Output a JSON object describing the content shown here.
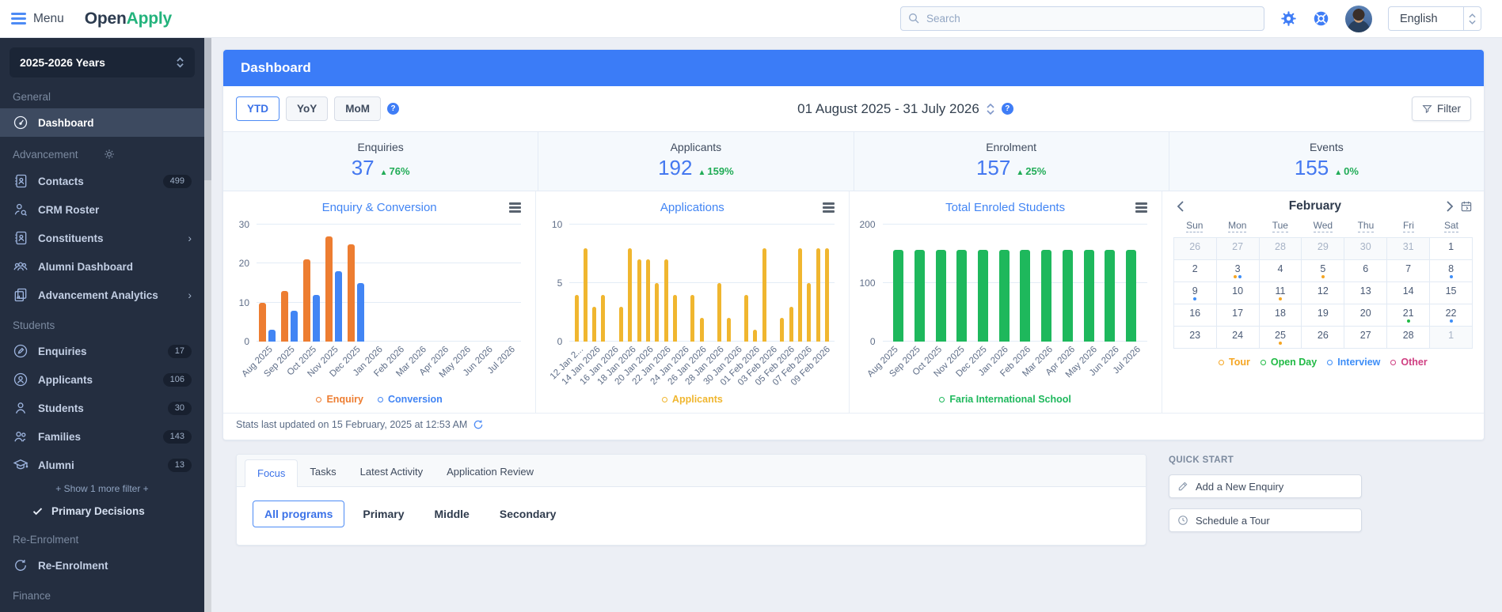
{
  "topbar": {
    "menu_label": "Menu",
    "logo_open": "Open",
    "logo_apply": "Apply",
    "search_placeholder": "Search",
    "language": "English",
    "icons": [
      "hamburger-icon",
      "search-icon",
      "gear-icon",
      "help-icon",
      "avatar"
    ]
  },
  "sidebar": {
    "year_selector": "2025-2026 Years",
    "groups": [
      {
        "label": "General",
        "items": [
          {
            "label": "Dashboard",
            "icon": "dashboard-gauge-icon",
            "active": true
          }
        ]
      },
      {
        "label": "Advancement",
        "gear_icon": "settings-gear-icon",
        "items": [
          {
            "label": "Contacts",
            "icon": "contacts-book-icon",
            "badge": "499"
          },
          {
            "label": "CRM Roster",
            "icon": "person-search-icon"
          },
          {
            "label": "Constituents",
            "icon": "constituents-book-icon",
            "chevron": true
          },
          {
            "label": "Alumni Dashboard",
            "icon": "people-group-icon"
          },
          {
            "label": "Advancement Analytics",
            "icon": "analytics-pages-icon",
            "chevron": true
          }
        ]
      },
      {
        "label": "Students",
        "items": [
          {
            "label": "Enquiries",
            "icon": "pencil-circle-icon",
            "badge": "17"
          },
          {
            "label": "Applicants",
            "icon": "person-circle-icon",
            "badge": "106"
          },
          {
            "label": "Students",
            "icon": "person-icon",
            "badge": "30"
          },
          {
            "label": "Families",
            "icon": "two-people-icon",
            "badge": "143"
          },
          {
            "label": "Alumni",
            "icon": "graduation-cap-icon",
            "badge": "13"
          }
        ],
        "show_more": "+ Show 1 more filter +",
        "decision_filter": "Primary Decisions"
      },
      {
        "label": "Re-Enrolment",
        "items": [
          {
            "label": "Re-Enrolment",
            "icon": "refresh-icon"
          }
        ]
      },
      {
        "label": "Finance",
        "items": []
      }
    ]
  },
  "main": {
    "title": "Dashboard",
    "period_buttons": [
      "YTD",
      "YoY",
      "MoM"
    ],
    "active_period": "YTD",
    "date_range": "01 August 2025 - 31 July 2026",
    "filter_label": "Filter",
    "stats": [
      {
        "label": "Enquiries",
        "value": "37",
        "delta": "76%"
      },
      {
        "label": "Applicants",
        "value": "192",
        "delta": "159%"
      },
      {
        "label": "Enrolment",
        "value": "157",
        "delta": "25%"
      },
      {
        "label": "Events",
        "value": "155",
        "delta": "0%"
      }
    ],
    "last_updated": "Stats last updated on 15 February, 2025 at 12:53 AM"
  },
  "chart_data": [
    {
      "type": "bar",
      "title": "Enquiry & Conversion",
      "categories": [
        "Aug 2025",
        "Sep 2025",
        "Oct 2025",
        "Nov 2025",
        "Dec 2025",
        "Jan 2026",
        "Feb 2026",
        "Mar 2026",
        "Apr 2026",
        "May 2026",
        "Jun 2026",
        "Jul 2026"
      ],
      "series": [
        {
          "name": "Enquiry",
          "color": "#ed7d31",
          "values": [
            10,
            13,
            21,
            27,
            25,
            0,
            0,
            0,
            0,
            0,
            0,
            0
          ]
        },
        {
          "name": "Conversion",
          "color": "#4285f4",
          "values": [
            3,
            8,
            12,
            18,
            15,
            0,
            0,
            0,
            0,
            0,
            0,
            0
          ]
        }
      ],
      "yticks": [
        0,
        10,
        20,
        30
      ],
      "ymax": 30,
      "grid": true,
      "legend_position": "bottom"
    },
    {
      "type": "bar",
      "title": "Applications",
      "x_labels": [
        "12 Jan 2...",
        "14 Jan 2026",
        "16 Jan 2026",
        "18 Jan 2026",
        "20 Jan 2026",
        "22 Jan 2026",
        "24 Jan 2026",
        "26 Jan 2026",
        "28 Jan 2026",
        "30 Jan 2026",
        "01 Feb 2026",
        "03 Feb 2026",
        "05 Feb 2026",
        "07 Feb 2026",
        "09 Feb 2026"
      ],
      "series": [
        {
          "name": "Applicants",
          "color": "#f0b62f",
          "values": [
            4,
            8,
            3,
            4,
            0,
            3,
            8,
            7,
            7,
            5,
            7,
            4,
            0,
            4,
            2,
            0,
            5,
            2,
            0,
            4,
            1,
            8,
            0,
            2,
            3,
            8,
            5,
            8,
            8
          ]
        }
      ],
      "yticks": [
        0,
        5,
        10
      ],
      "ymax": 10,
      "grid": true,
      "legend_position": "bottom"
    },
    {
      "type": "bar",
      "title": "Total Enroled Students",
      "categories": [
        "Aug 2025",
        "Sep 2025",
        "Oct 2025",
        "Nov 2025",
        "Dec 2025",
        "Jan 2026",
        "Feb 2026",
        "Mar 2026",
        "Apr 2026",
        "May 2026",
        "Jun 2026",
        "Jul 2026"
      ],
      "series": [
        {
          "name": "Faria International School",
          "color": "#1eb85c",
          "values": [
            157,
            157,
            157,
            157,
            157,
            157,
            157,
            157,
            157,
            157,
            157,
            157
          ]
        }
      ],
      "yticks": [
        0,
        100,
        200
      ],
      "ymax": 200,
      "grid": true,
      "legend_position": "bottom"
    }
  ],
  "calendar": {
    "month": "February",
    "day_headers": [
      "Sun",
      "Mon",
      "Tue",
      "Wed",
      "Thu",
      "Fri",
      "Sat"
    ],
    "weeks": [
      [
        {
          "d": "26",
          "muted": true
        },
        {
          "d": "27",
          "muted": true
        },
        {
          "d": "28",
          "muted": true
        },
        {
          "d": "29",
          "muted": true
        },
        {
          "d": "30",
          "muted": true
        },
        {
          "d": "31",
          "muted": true
        },
        {
          "d": "1"
        }
      ],
      [
        {
          "d": "2"
        },
        {
          "d": "3",
          "dots": [
            "tour",
            "interview"
          ]
        },
        {
          "d": "4"
        },
        {
          "d": "5",
          "dots": [
            "tour"
          ]
        },
        {
          "d": "6"
        },
        {
          "d": "7"
        },
        {
          "d": "8",
          "dots": [
            "interview"
          ]
        }
      ],
      [
        {
          "d": "9",
          "dots": [
            "interview"
          ]
        },
        {
          "d": "10"
        },
        {
          "d": "11",
          "dots": [
            "tour"
          ]
        },
        {
          "d": "12"
        },
        {
          "d": "13"
        },
        {
          "d": "14"
        },
        {
          "d": "15"
        }
      ],
      [
        {
          "d": "16"
        },
        {
          "d": "17"
        },
        {
          "d": "18"
        },
        {
          "d": "19"
        },
        {
          "d": "20"
        },
        {
          "d": "21",
          "dots": [
            "open_day"
          ]
        },
        {
          "d": "22",
          "dots": [
            "interview"
          ]
        }
      ],
      [
        {
          "d": "23"
        },
        {
          "d": "24"
        },
        {
          "d": "25",
          "dots": [
            "tour"
          ]
        },
        {
          "d": "26"
        },
        {
          "d": "27"
        },
        {
          "d": "28"
        },
        {
          "d": "1",
          "muted": true
        }
      ]
    ],
    "legend": [
      {
        "key": "tour",
        "label": "Tour",
        "color": "#f5a623"
      },
      {
        "key": "open_day",
        "label": "Open Day",
        "color": "#21ba45"
      },
      {
        "key": "interview",
        "label": "Interview",
        "color": "#3e8ef7"
      },
      {
        "key": "other",
        "label": "Other",
        "color": "#cf3e81"
      }
    ]
  },
  "bottom": {
    "tabs": [
      "Focus",
      "Tasks",
      "Latest Activity",
      "Application Review"
    ],
    "active_tab": "Focus",
    "programs": [
      "All programs",
      "Primary",
      "Middle",
      "Secondary"
    ],
    "active_program": "All programs"
  },
  "quick_start": {
    "label": "QUICK START",
    "actions": [
      "Add a New Enquiry",
      "Schedule a Tour"
    ],
    "icons": [
      "pencil-icon",
      "clock-icon"
    ]
  },
  "colors": {
    "header_blue": "#3b7cf7",
    "stat_blue": "#4478f0",
    "positive_green": "#21ac57",
    "enquiry_orange": "#ed7d31",
    "conversion_blue": "#4285f4",
    "applications_yellow": "#f0b62f",
    "enrolment_green": "#1eb85c",
    "sidebar_bg": "#242e40",
    "logo_green": "#23b37c"
  }
}
